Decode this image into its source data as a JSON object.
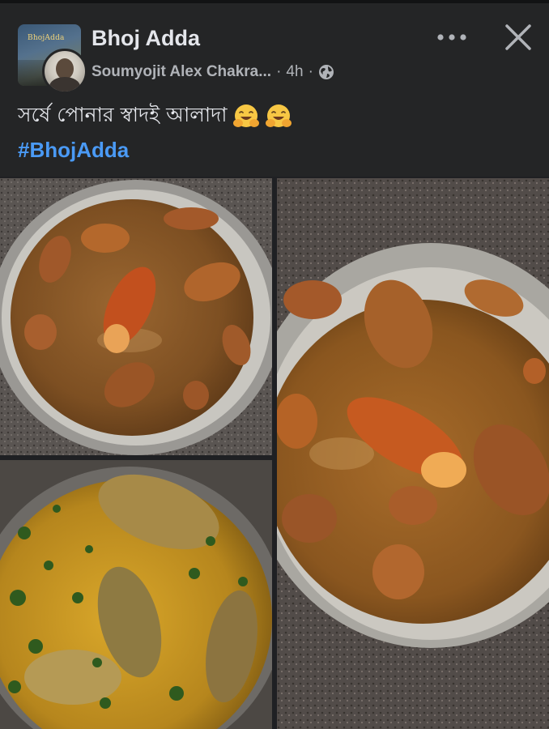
{
  "post": {
    "group_name": "Bhoj Adda",
    "group_avatar_text": "BhojAdda",
    "author": "Soumyojit Alex Chakra...",
    "separator": "·",
    "time": "4h",
    "text": "সর্ষে পোনার স্বাদই আলাদা",
    "emojis": [
      "hugging-face",
      "hugging-face"
    ],
    "hashtag": "#BhojAdda"
  },
  "icons": {
    "more": "more-horizontal-icon",
    "close": "close-icon",
    "audience": "globe-icon"
  },
  "colors": {
    "background": "#242526",
    "text_primary": "#e4e6eb",
    "text_secondary": "#b0b3b8",
    "hashtag": "#4a9af5"
  },
  "photos": [
    {
      "name": "prawn-curry-bowl-top-left"
    },
    {
      "name": "mustard-fish-curry-bottom-left"
    },
    {
      "name": "prawn-curry-bowl-right"
    }
  ]
}
